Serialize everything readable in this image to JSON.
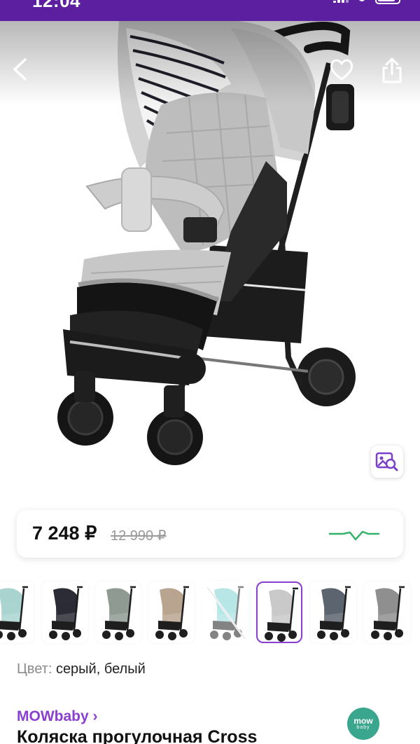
{
  "status_bar": {
    "time": "12:04",
    "color": "#5b1f9f"
  },
  "navigation": {
    "back_icon": "chevron-left-icon",
    "favorite_icon": "heart-icon",
    "share_icon": "share-icon"
  },
  "gallery": {
    "visual_search_icon": "image-search-icon"
  },
  "price": {
    "current": "7 248 ₽",
    "old": "12 990 ₽",
    "trend_icon": "price-chart-icon",
    "trend_color": "#35b36a"
  },
  "color_variants": [
    {
      "name": "mint",
      "hue": "#a9d3cf",
      "selected": false,
      "available": true
    },
    {
      "name": "black",
      "hue": "#2c2c36",
      "selected": false,
      "available": true
    },
    {
      "name": "grey-stripes",
      "hue": "#8f9a93",
      "selected": false,
      "available": true
    },
    {
      "name": "beige",
      "hue": "#b9a48f",
      "selected": false,
      "available": true
    },
    {
      "name": "turquoise",
      "hue": "#7fd3d5",
      "selected": false,
      "available": false
    },
    {
      "name": "grey-white",
      "hue": "#c9c9c9",
      "selected": true,
      "available": true
    },
    {
      "name": "dark-grey",
      "hue": "#5c6470",
      "selected": false,
      "available": true
    },
    {
      "name": "grey",
      "hue": "#8f8f8f",
      "selected": false,
      "available": true
    }
  ],
  "color_info": {
    "label": "Цвет:",
    "value": "серый, белый"
  },
  "brand": {
    "name": "MOWbaby ›",
    "logo_line1": "mow",
    "logo_line2": "baby",
    "logo_color": "#3aa68e"
  },
  "product": {
    "title": "Коляска прогулочная Cross"
  },
  "accent_color": "#8b3fd0"
}
